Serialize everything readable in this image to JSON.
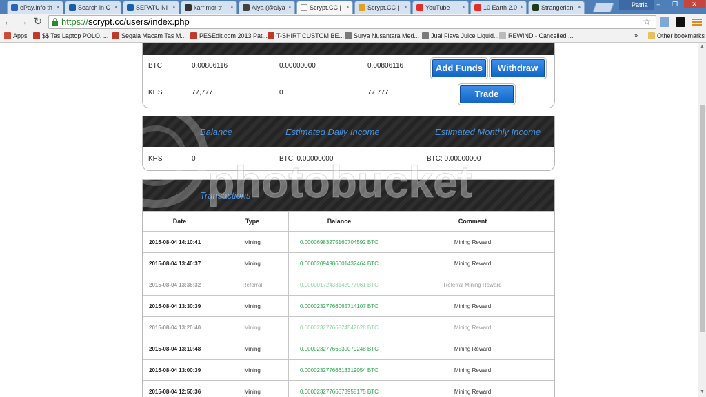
{
  "browser": {
    "tabs": [
      {
        "label": "ePay.info th",
        "color": "#2d63b3"
      },
      {
        "label": "Search in C",
        "color": "#1b5ea8"
      },
      {
        "label": "SEPATU NI",
        "color": "#1b5ea8"
      },
      {
        "label": "karrimor tr",
        "color": "#333333"
      },
      {
        "label": "Alya (@alya",
        "color": "#444444"
      },
      {
        "label": "Scrypt.CC |",
        "color": "#ffffff",
        "active": true
      },
      {
        "label": "Scrypt.CC |",
        "color": "#e6a21f"
      },
      {
        "label": "YouTube",
        "color": "#e52d27"
      },
      {
        "label": "10 Earth 2.0",
        "color": "#e52d27"
      },
      {
        "label": "Strangerlan",
        "color": "#1b3d1b"
      }
    ],
    "user_name": "Patria",
    "url_scheme": "https://",
    "url_rest": "scrypt.cc/users/index.php",
    "bookmarks": [
      {
        "label": "Apps"
      },
      {
        "label": "$$ Tas Laptop POLO, ..."
      },
      {
        "label": "Segala Macam Tas M..."
      },
      {
        "label": "PESEdit.com 2013 Pat..."
      },
      {
        "label": "T-SHIRT CUSTOM BE..."
      },
      {
        "label": "Surya Nusantara Med..."
      },
      {
        "label": "Jual Flava Juice Liquid..."
      },
      {
        "label": "REWIND - Cancelled ..."
      }
    ],
    "more_bookmarks": "»",
    "other_bookmarks": "Other bookmarks"
  },
  "balances": {
    "rows": [
      {
        "currency": "BTC",
        "c1": "0.00806116",
        "c2": "0.00000000",
        "c3": "0.00806116"
      },
      {
        "currency": "KHS",
        "c1": "77,777",
        "c2": "0",
        "c3": "77,777"
      }
    ],
    "add_funds_label": "Add Funds",
    "withdraw_label": "Withdraw",
    "trade_label": "Trade"
  },
  "income": {
    "headers": {
      "balance": "Balance",
      "daily": "Estimated Daily Income",
      "monthly": "Estimated Monthly Income"
    },
    "row": {
      "currency": "KHS",
      "balance": "0",
      "daily": "BTC: 0.00000000",
      "monthly": "BTC: 0.00000000"
    }
  },
  "transactions": {
    "title": "Transactions",
    "columns": [
      "Date",
      "Type",
      "Balance",
      "Comment"
    ],
    "rows": [
      {
        "date": "2015-08-04 14:10:41",
        "type": "Mining",
        "balance": "0.00006983275160704592 BTC",
        "comment": "Mining Reward"
      },
      {
        "date": "2015-08-04 13:40:37",
        "type": "Mining",
        "balance": "0.00002094986001432464 BTC",
        "comment": "Mining Reward"
      },
      {
        "date": "2015-08-04 13:36:32",
        "type": "Referral",
        "balance": "0.00000172433143977061 BTC",
        "comment": "Referral Mining Reward"
      },
      {
        "date": "2015-08-04 13:30:39",
        "type": "Mining",
        "balance": "0.00002327766065714107 BTC",
        "comment": "Mining Reward"
      },
      {
        "date": "2015-08-04 13:20:40",
        "type": "Mining",
        "balance": "0.00002327766524542628 BTC",
        "comment": "Mining Reward"
      },
      {
        "date": "2015-08-04 13:10:48",
        "type": "Mining",
        "balance": "0.00002327766530079248 BTC",
        "comment": "Mining Reward"
      },
      {
        "date": "2015-08-04 13:00:39",
        "type": "Mining",
        "balance": "0.00002327766613319054 BTC",
        "comment": "Mining Reward"
      },
      {
        "date": "2015-08-04 12:50:36",
        "type": "Mining",
        "balance": "0.00002327766673958175 BTC",
        "comment": "Mining Reward"
      }
    ]
  },
  "watermark": "photobucket"
}
